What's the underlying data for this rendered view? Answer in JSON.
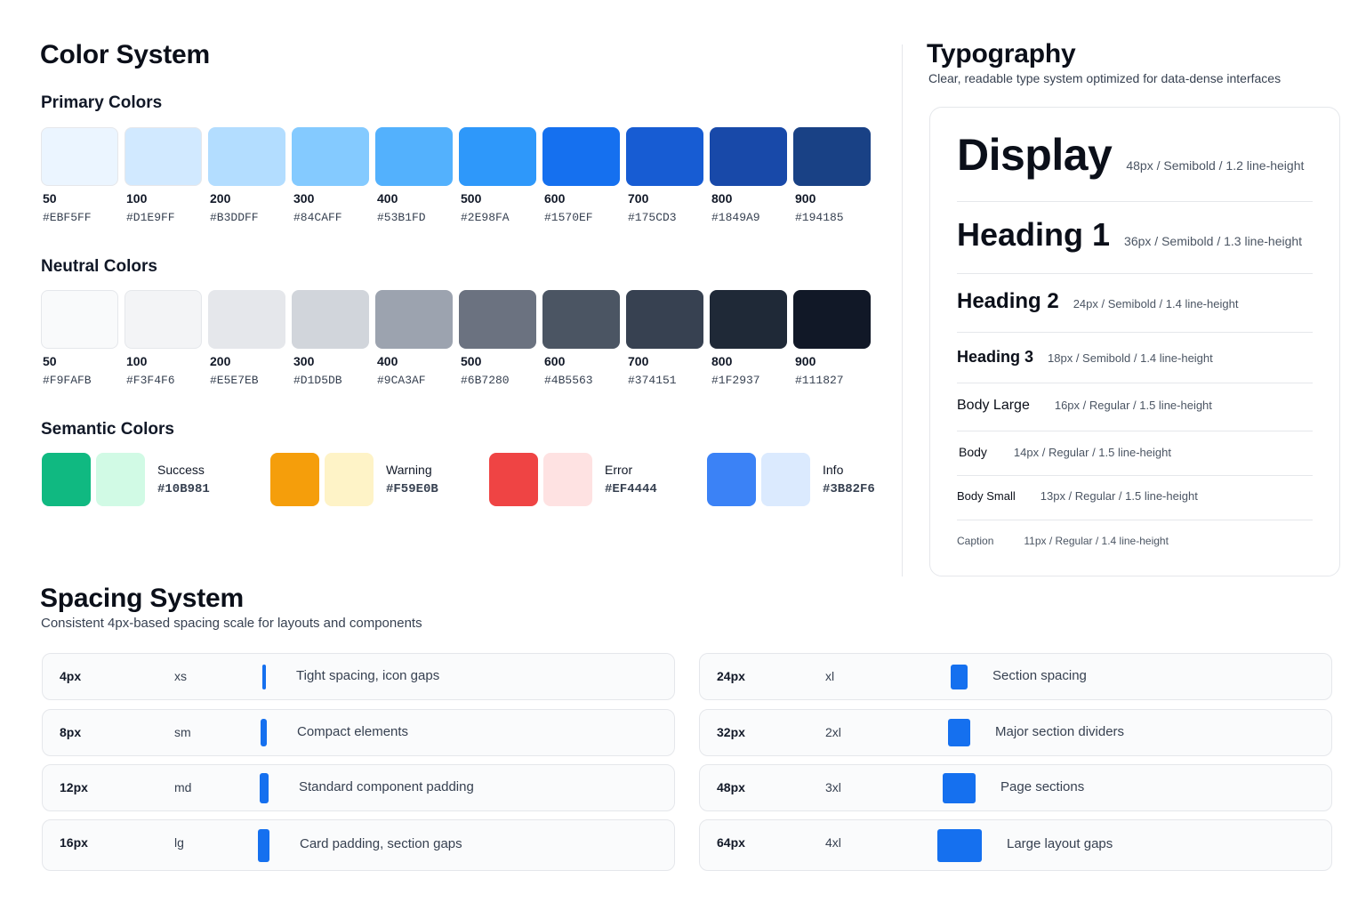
{
  "color_system": {
    "title": "Color System",
    "primary": {
      "title": "Primary Colors",
      "swatches": [
        {
          "name": "50",
          "hex": "#EBF5FF"
        },
        {
          "name": "100",
          "hex": "#D1E9FF"
        },
        {
          "name": "200",
          "hex": "#B3DDFF"
        },
        {
          "name": "300",
          "hex": "#84CAFF"
        },
        {
          "name": "400",
          "hex": "#53B1FD"
        },
        {
          "name": "500",
          "hex": "#2E98FA"
        },
        {
          "name": "600",
          "hex": "#1570EF"
        },
        {
          "name": "700",
          "hex": "#175CD3"
        },
        {
          "name": "800",
          "hex": "#1849A9"
        },
        {
          "name": "900",
          "hex": "#194185"
        }
      ]
    },
    "neutral": {
      "title": "Neutral Colors",
      "swatches": [
        {
          "name": "50",
          "hex": "#F9FAFB"
        },
        {
          "name": "100",
          "hex": "#F3F4F6"
        },
        {
          "name": "200",
          "hex": "#E5E7EB"
        },
        {
          "name": "300",
          "hex": "#D1D5DB"
        },
        {
          "name": "400",
          "hex": "#9CA3AF"
        },
        {
          "name": "500",
          "hex": "#6B7280"
        },
        {
          "name": "600",
          "hex": "#4B5563"
        },
        {
          "name": "700",
          "hex": "#374151"
        },
        {
          "name": "800",
          "hex": "#1F2937"
        },
        {
          "name": "900",
          "hex": "#111827"
        }
      ]
    },
    "semantic": {
      "title": "Semantic Colors",
      "items": [
        {
          "name": "Success",
          "hex": "#10B981",
          "tint": "#D1FAE5"
        },
        {
          "name": "Warning",
          "hex": "#F59E0B",
          "tint": "#FEF3C7"
        },
        {
          "name": "Error",
          "hex": "#EF4444",
          "tint": "#FEE2E2"
        },
        {
          "name": "Info",
          "hex": "#3B82F6",
          "tint": "#DBEAFE"
        }
      ]
    }
  },
  "typography": {
    "title": "Typography",
    "subtitle": "Clear, readable type system optimized for data-dense interfaces",
    "styles": [
      {
        "name": "Display",
        "meta": "48px / Semibold / 1.2 line-height"
      },
      {
        "name": "Heading 1",
        "meta": "36px / Semibold / 1.3 line-height"
      },
      {
        "name": "Heading 2",
        "meta": "24px / Semibold / 1.4 line-height"
      },
      {
        "name": "Heading 3",
        "meta": "18px / Semibold / 1.4 line-height"
      },
      {
        "name": "Body Large",
        "meta": "16px / Regular / 1.5 line-height"
      },
      {
        "name": "Body",
        "meta": "14px / Regular / 1.5 line-height"
      },
      {
        "name": "Body Small",
        "meta": "13px / Regular / 1.5 line-height"
      },
      {
        "name": "Caption",
        "meta": "11px / Regular / 1.4 line-height"
      }
    ]
  },
  "spacing": {
    "title": "Spacing System",
    "subtitle": "Consistent 4px-based spacing scale for layouts and components",
    "rows": [
      {
        "size": "4px",
        "token": "xs",
        "desc": "Tight spacing, icon gaps",
        "value": 4
      },
      {
        "size": "8px",
        "token": "sm",
        "desc": "Compact elements",
        "value": 8
      },
      {
        "size": "12px",
        "token": "md",
        "desc": "Standard component padding",
        "value": 12
      },
      {
        "size": "16px",
        "token": "lg",
        "desc": "Card padding, section gaps",
        "value": 16
      },
      {
        "size": "24px",
        "token": "xl",
        "desc": "Section spacing",
        "value": 24
      },
      {
        "size": "32px",
        "token": "2xl",
        "desc": "Major section dividers",
        "value": 32
      },
      {
        "size": "48px",
        "token": "3xl",
        "desc": "Page sections",
        "value": 48
      },
      {
        "size": "64px",
        "token": "4xl",
        "desc": "Large layout gaps",
        "value": 64
      }
    ]
  }
}
